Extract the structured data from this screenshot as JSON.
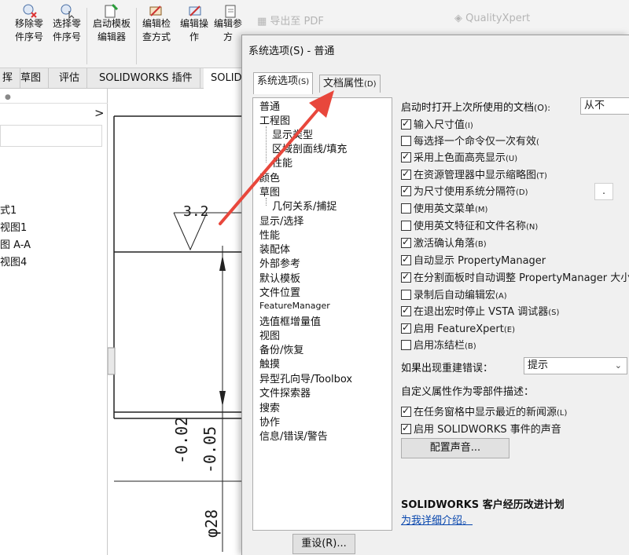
{
  "ribbon": {
    "buttons": [
      {
        "line1": "移除零",
        "line2": "件序号"
      },
      {
        "line1": "选择零",
        "line2": "件序号"
      },
      {
        "line1": "启动模板",
        "line2": "编辑器"
      },
      {
        "line1": "编辑检",
        "line2": "查方式"
      },
      {
        "line1": "编辑操",
        "line2": "作"
      },
      {
        "line1": "编辑参",
        "line2": "方"
      }
    ],
    "export_pdf": "导出至 PDF",
    "quality_xpert": "QualityXpert"
  },
  "tabs": [
    "挥",
    "草图",
    "评估",
    "SOLIDWORKS 插件",
    "SOLID"
  ],
  "left_panel": {
    "chevron": ">",
    "items": [
      "式1",
      "视图1",
      "图 A-A",
      "视图4"
    ]
  },
  "drawing": {
    "roughness": "3.2",
    "tol1": "-0.02",
    "tol2": "-0.05",
    "dim": "φ28"
  },
  "dialog": {
    "title": "系统选项(S) - 普通",
    "tab_system": "系统选项",
    "tab_system_key": "(S)",
    "tab_doc": "文档属性",
    "tab_doc_key": "(D)",
    "tree": [
      "普通",
      "工程图",
      "显示类型",
      "区域剖面线/填充",
      "性能",
      "颜色",
      "草图",
      "几何关系/捕捉",
      "显示/选择",
      "性能",
      "装配体",
      "外部参考",
      "默认模板",
      "文件位置",
      "FeatureManager",
      "选值框增量值",
      "视图",
      "备份/恢复",
      "触摸",
      "异型孔向导/Toolbox",
      "文件探索器",
      "搜索",
      "协作",
      "信息/错误/警告"
    ],
    "reset_button": "重设(R)...",
    "startup_label": "启动时打开上次所使用的文档",
    "startup_key": "(O):",
    "startup_value": "从不",
    "checkboxes": [
      {
        "label": "输入尺寸值",
        "key": "(I)",
        "checked": true
      },
      {
        "label": "每选择一个命令仅一次有效",
        "key": "(",
        "checked": false
      },
      {
        "label": "采用上色面高亮显示",
        "key": "(U)",
        "checked": true
      },
      {
        "label": "在资源管理器中显示缩略图",
        "key": "(T)",
        "checked": true
      },
      {
        "label": "为尺寸使用系统分隔符",
        "key": "(D)",
        "checked": true
      },
      {
        "label": "使用英文菜单",
        "key": "(M)",
        "checked": false
      },
      {
        "label": "使用英文特征和文件名称",
        "key": "(N)",
        "checked": false
      },
      {
        "label": "激活确认角落",
        "key": "(B)",
        "checked": true
      },
      {
        "label": "自动显示 PropertyManager",
        "key": "",
        "checked": true
      },
      {
        "label": "在分割面板时自动调整 PropertyManager 大小",
        "key": "",
        "checked": true
      },
      {
        "label": "录制后自动编辑宏",
        "key": "(A)",
        "checked": false
      },
      {
        "label": "在退出宏时停止 VSTA 调试器",
        "key": "(S)",
        "checked": true
      },
      {
        "label": "启用 FeatureXpert",
        "key": "(E)",
        "checked": true
      },
      {
        "label": "启用冻结栏",
        "key": "(B)",
        "checked": false
      }
    ],
    "separator_value": ".",
    "rebuild_error_label": "如果出现重建错误：",
    "rebuild_error_value": "提示",
    "custom_prop_label": "自定义属性作为零部件描述：",
    "checkboxes2": [
      {
        "label": "在任务窗格中显示最近的新闻源",
        "key": "(L)",
        "checked": true
      },
      {
        "label": "启用 SOLIDWORKS 事件的声音",
        "key": "",
        "checked": true
      }
    ],
    "config_sound_button": "配置声音...",
    "ceip_title": "SOLIDWORKS 客户经历改进计划",
    "ceip_link": "为我详细介绍。"
  },
  "colors": {
    "accent_arrow": "#e8473c",
    "link": "#0645ad"
  }
}
